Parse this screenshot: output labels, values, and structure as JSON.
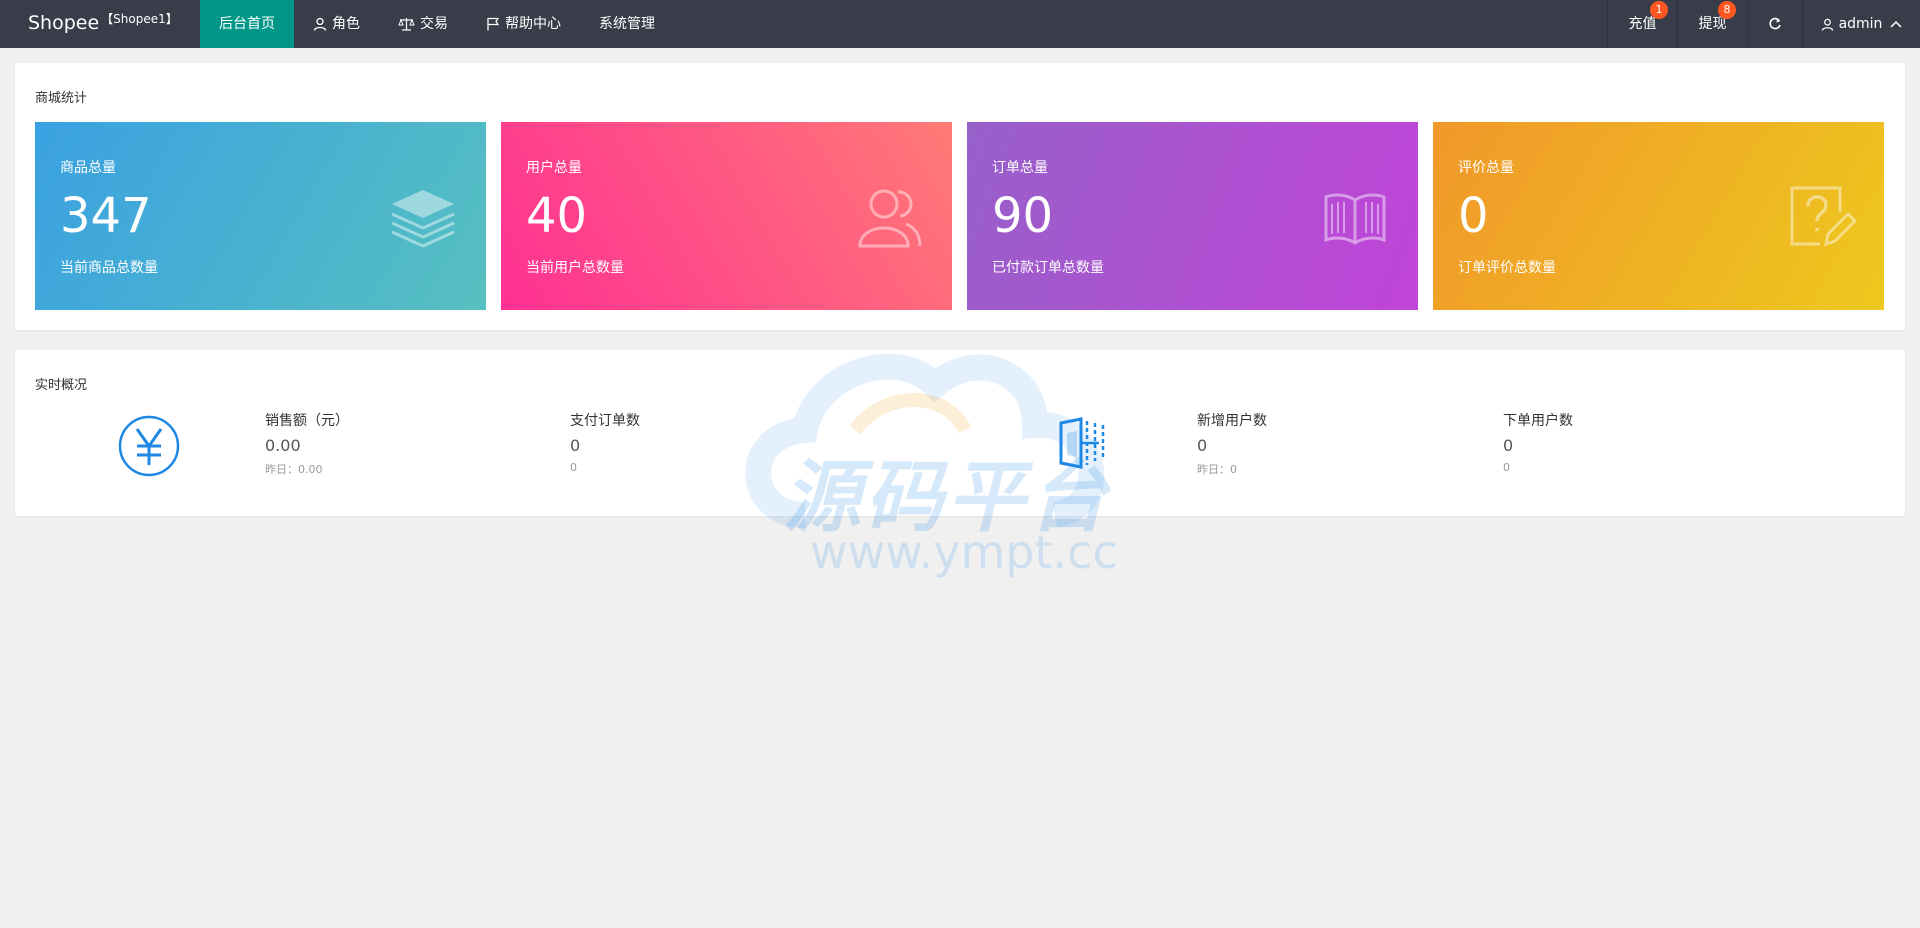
{
  "header": {
    "logo": "Shopee",
    "shop_name": "【Shopee1】",
    "nav": [
      {
        "label": "后台首页",
        "icon": ""
      },
      {
        "label": "角色",
        "icon": "user-icon"
      },
      {
        "label": "交易",
        "icon": "scale-icon"
      },
      {
        "label": "帮助中心",
        "icon": "flag-icon"
      },
      {
        "label": "系统管理",
        "icon": ""
      }
    ],
    "right": {
      "recharge": {
        "label": "充值",
        "badge": "1"
      },
      "withdraw": {
        "label": "提现",
        "badge": "8"
      },
      "refresh_icon": "refresh-icon",
      "user": {
        "label": "admin",
        "icon": "user-icon",
        "caret": "chevron-up-icon"
      }
    }
  },
  "mall_stats": {
    "title": "商城统计",
    "cards": [
      {
        "label": "商品总量",
        "value": "347",
        "desc": "当前商品总数量",
        "icon": "layers-icon",
        "colors": [
          "#3aa1e2",
          "#56c0c0"
        ]
      },
      {
        "label": "用户总量",
        "value": "40",
        "desc": "当前用户总数量",
        "icon": "users-icon",
        "colors": [
          "#ff3093",
          "#ff7a76"
        ]
      },
      {
        "label": "订单总量",
        "value": "90",
        "desc": "已付款订单总数量",
        "icon": "book-icon",
        "colors": [
          "#9760c9",
          "#c144d8"
        ]
      },
      {
        "label": "评价总量",
        "value": "0",
        "desc": "订单评价总数量",
        "icon": "question-edit-icon",
        "colors": [
          "#f1982a",
          "#edc81e"
        ]
      }
    ]
  },
  "realtime": {
    "title": "实时概况",
    "left_icon": "yuan-icon",
    "mid_icon": "door-icon",
    "items": [
      {
        "label": "销售额（元）",
        "value": "0.00",
        "sub": "昨日：0.00"
      },
      {
        "label": "支付订单数",
        "value": "0",
        "sub": "0"
      },
      {
        "label": "新增用户数",
        "value": "0",
        "sub": "昨日：0"
      },
      {
        "label": "下单用户数",
        "value": "0",
        "sub": "0"
      }
    ]
  },
  "watermark": {
    "text": "源码平台",
    "url": "www.ympt.cc"
  },
  "colors": {
    "header_bg": "#393d49",
    "nav_active": "#009688",
    "badge": "#ff5722",
    "accent_blue": "#1e88e5"
  }
}
